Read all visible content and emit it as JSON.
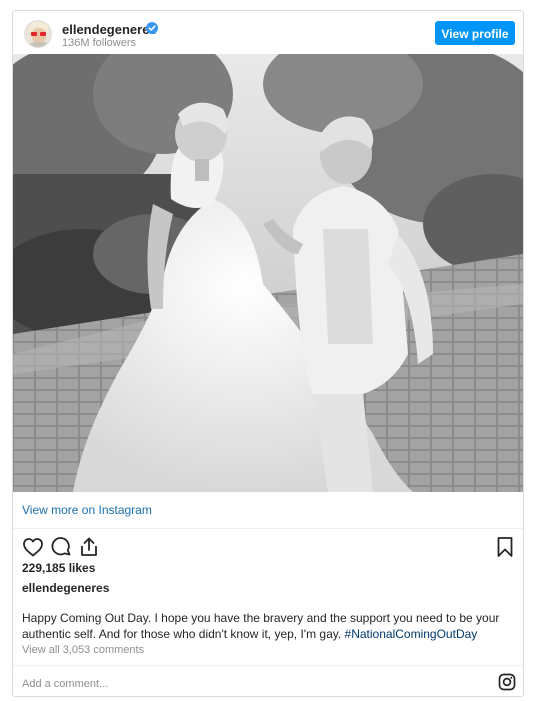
{
  "header": {
    "username": "ellendegeneres",
    "followers": "136M followers",
    "view_profile_label": "View profile"
  },
  "post": {
    "view_more_label": "View more on Instagram",
    "likes": "229,185 likes",
    "owner": "ellendegeneres",
    "caption_text": "Happy Coming Out Day. I hope you have the bravery and the support you need to be your authentic self. And for those who didn't know it, yep, I'm gay.",
    "caption_hashtag": "#NationalComingOutDay",
    "comments_label": "View all 3,053 comments",
    "add_comment_placeholder": "Add a comment..."
  },
  "colors": {
    "accent": "#0095f6",
    "link": "#1a6fb0",
    "hashtag": "#00376b",
    "muted": "#8e8e8e",
    "border": "#dbdbdb"
  },
  "icons": [
    "heart-icon",
    "comment-icon",
    "share-icon",
    "bookmark-icon",
    "instagram-icon",
    "verified-badge-icon"
  ]
}
